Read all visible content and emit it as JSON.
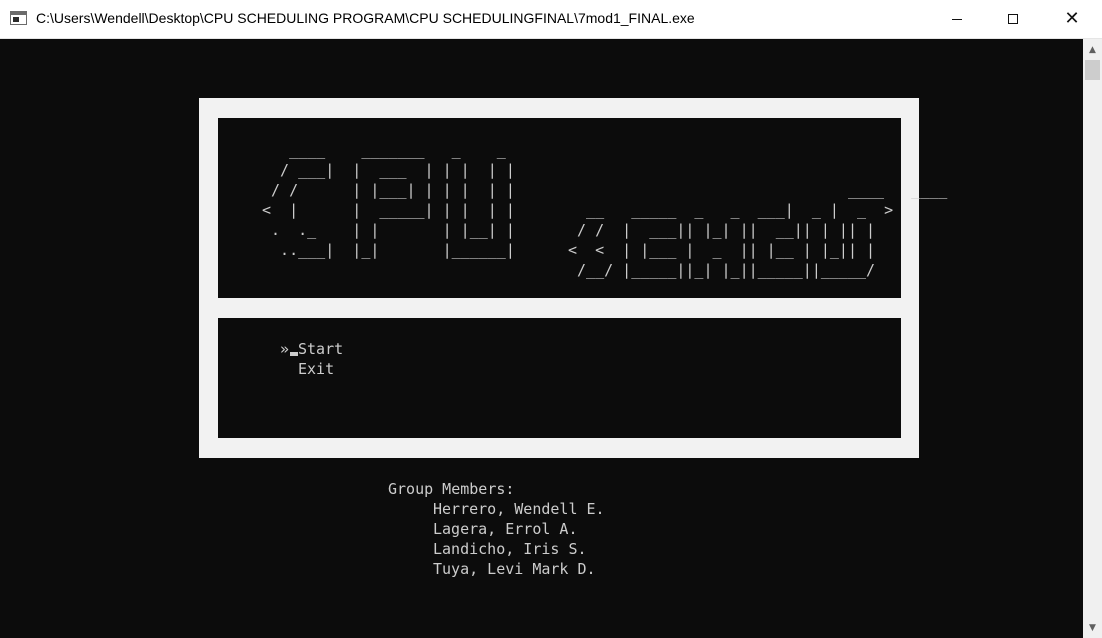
{
  "window": {
    "title": "C:\\Users\\Wendell\\Desktop\\CPU SCHEDULING PROGRAM\\CPU SCHEDULINGFINAL\\7mod1_FINAL.exe",
    "close_glyph": "✕"
  },
  "logo": {
    "cpu_art": "   ____    _______   _    _\n  / ___|  |  ___  | | |  | |\n / /      | |___| | | |  | |\n<  |      |  _____| | |  | |\n .  ._    | |       | |__| |\n  ..___|  |_|       |______|",
    "sched_art": "                               ____   ____\n  __   _____  _   _  ___|  _ |  _  >\n / /  |  ___|| |_| ||  __|| | || |\n<  <  | |___ |  _  || |__ | |_|| |\n /__/ |_____||_| |_||_____||_____/"
  },
  "menu": {
    "pointer": "»",
    "items": [
      "Start",
      "Exit"
    ]
  },
  "group": {
    "heading": "Group Members:",
    "members": [
      "Herrero, Wendell E.",
      "Lagera, Errol A.",
      "Landicho, Iris S.",
      "Tuya, Levi Mark D."
    ]
  },
  "colors": {
    "console_bg": "#0c0c0c",
    "console_text": "#cccccc",
    "frame": "#f2f2f2"
  }
}
